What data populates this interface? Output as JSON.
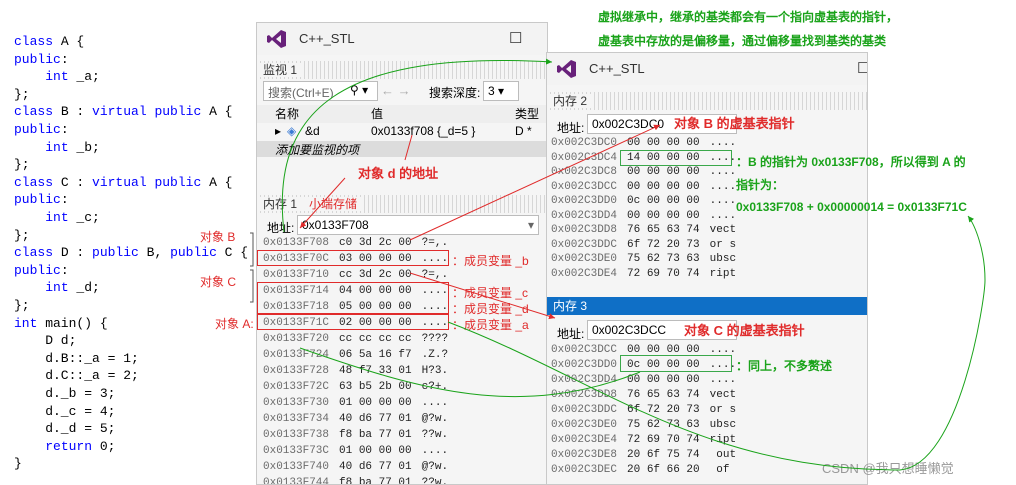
{
  "code": [
    "class A {",
    "public:",
    "    int _a;",
    "};",
    "class B : virtual public A {",
    "public:",
    "    int _b;",
    "};",
    "class C : virtual public A {",
    "public:",
    "    int _c;",
    "};",
    "class D : public B, public C {",
    "public:",
    "    int _d;",
    "};",
    "int main() {",
    "    D d;",
    "    d.B::_a = 1;",
    "    d.C::_a = 2;",
    "    d._b = 3;",
    "    d._c = 4;",
    "    d._d = 5;",
    "    return 0;",
    "}"
  ],
  "watch_window": {
    "title": "C++_STL",
    "panel_title": "监视 1",
    "search_placeholder": "搜索(Ctrl+E)",
    "search_icon": "magnifier-icon",
    "search_depth_label": "搜索深度:",
    "search_depth_value": "3",
    "columns": [
      "名称",
      "值",
      "类型"
    ],
    "row": {
      "name": "&d",
      "value": "0x0133f708 {_d=5 }",
      "type": "D *"
    },
    "add_item": "添加要监视的项"
  },
  "memory1": {
    "title": "内存 1",
    "subtitle": "小端存储",
    "address_label": "地址:",
    "address_value": "0x0133F708",
    "rows": [
      {
        "addr": "0x0133F708",
        "bytes": "c0 3d 2c 00",
        "ascii": "?=,."
      },
      {
        "addr": "0x0133F70C",
        "bytes": "03 00 00 00",
        "ascii": "...."
      },
      {
        "addr": "0x0133F710",
        "bytes": "cc 3d 2c 00",
        "ascii": "?=,."
      },
      {
        "addr": "0x0133F714",
        "bytes": "04 00 00 00",
        "ascii": "...."
      },
      {
        "addr": "0x0133F718",
        "bytes": "05 00 00 00",
        "ascii": "...."
      },
      {
        "addr": "0x0133F71C",
        "bytes": "02 00 00 00",
        "ascii": "...."
      },
      {
        "addr": "0x0133F720",
        "bytes": "cc cc cc cc",
        "ascii": "????"
      },
      {
        "addr": "0x0133F724",
        "bytes": "06 5a 16 f7",
        "ascii": ".Z.?"
      },
      {
        "addr": "0x0133F728",
        "bytes": "48 f7 33 01",
        "ascii": "H?3."
      },
      {
        "addr": "0x0133F72C",
        "bytes": "63 b5 2b 00",
        "ascii": "c?+."
      },
      {
        "addr": "0x0133F730",
        "bytes": "01 00 00 00",
        "ascii": "...."
      },
      {
        "addr": "0x0133F734",
        "bytes": "40 d6 77 01",
        "ascii": "@?w."
      },
      {
        "addr": "0x0133F738",
        "bytes": "f8 ba 77 01",
        "ascii": "??w."
      },
      {
        "addr": "0x0133F73C",
        "bytes": "01 00 00 00",
        "ascii": "...."
      },
      {
        "addr": "0x0133F740",
        "bytes": "40 d6 77 01",
        "ascii": "@?w."
      },
      {
        "addr": "0x0133F744",
        "bytes": "f8 ba 77 01",
        "ascii": "??w."
      }
    ]
  },
  "window2": {
    "title": "C++_STL"
  },
  "memory2": {
    "title": "内存 2",
    "address_label": "地址:",
    "address_value": "0x002C3DC0",
    "rows": [
      {
        "addr": "0x002C3DC0",
        "bytes": "00 00 00 00",
        "ascii": "...."
      },
      {
        "addr": "0x002C3DC4",
        "bytes": "14 00 00 00",
        "ascii": "...."
      },
      {
        "addr": "0x002C3DC8",
        "bytes": "00 00 00 00",
        "ascii": "...."
      },
      {
        "addr": "0x002C3DCC",
        "bytes": "00 00 00 00",
        "ascii": "...."
      },
      {
        "addr": "0x002C3DD0",
        "bytes": "0c 00 00 00",
        "ascii": "...."
      },
      {
        "addr": "0x002C3DD4",
        "bytes": "00 00 00 00",
        "ascii": "...."
      },
      {
        "addr": "0x002C3DD8",
        "bytes": "76 65 63 74",
        "ascii": "vect"
      },
      {
        "addr": "0x002C3DDC",
        "bytes": "6f 72 20 73",
        "ascii": "or s"
      },
      {
        "addr": "0x002C3DE0",
        "bytes": "75 62 73 63",
        "ascii": "ubsc"
      },
      {
        "addr": "0x002C3DE4",
        "bytes": "72 69 70 74",
        "ascii": "ript"
      }
    ]
  },
  "memory3": {
    "title": "内存 3",
    "address_label": "地址:",
    "address_value": "0x002C3DCC",
    "rows": [
      {
        "addr": "0x002C3DCC",
        "bytes": "00 00 00 00",
        "ascii": "...."
      },
      {
        "addr": "0x002C3DD0",
        "bytes": "0c 00 00 00",
        "ascii": "...."
      },
      {
        "addr": "0x002C3DD4",
        "bytes": "00 00 00 00",
        "ascii": "...."
      },
      {
        "addr": "0x002C3DD8",
        "bytes": "76 65 63 74",
        "ascii": "vect"
      },
      {
        "addr": "0x002C3DDC",
        "bytes": "6f 72 20 73",
        "ascii": "or s"
      },
      {
        "addr": "0x002C3DE0",
        "bytes": "75 62 73 63",
        "ascii": "ubsc"
      },
      {
        "addr": "0x002C3DE4",
        "bytes": "72 69 70 74",
        "ascii": "ript"
      },
      {
        "addr": "0x002C3DE8",
        "bytes": "20 6f 75 74",
        "ascii": " out"
      },
      {
        "addr": "0x002C3DEC",
        "bytes": "20 6f 66 20",
        "ascii": " of "
      }
    ]
  },
  "annotations": {
    "top_note_1": "虚拟继承中，继承的基类都会有一个指向虚基表的指针，",
    "top_note_2": "虚基表中存放的是偏移量，通过偏移量找到基类的基类",
    "d_address": "对象 d 的地址",
    "b_vbtable": "对象 B 的虚基表指针",
    "c_vbtable": "对象 C 的虚基表指针",
    "obj_b": "对象 B",
    "obj_c": "对象 C",
    "obj_a": "对象 A:",
    "member_b": "：成员变量 _b",
    "member_c": "：成员变量 _c",
    "member_d": "：成员变量 _d",
    "member_a": "：成员变量 _a",
    "b_ptr_1": "：B 的指针为 0x0133F708，所以得到 A 的",
    "b_ptr_2": "指针为：",
    "b_ptr_calc": "0x0133F708 + 0x00000014 = 0x0133F71C",
    "same_note": "：同上，不多赘述",
    "watermark": "CSDN @我只想睡懒觉"
  },
  "colors": {
    "annotation_red": "#e02b2b",
    "annotation_green": "#1aa31a",
    "active_header": "#0f6fc6"
  }
}
